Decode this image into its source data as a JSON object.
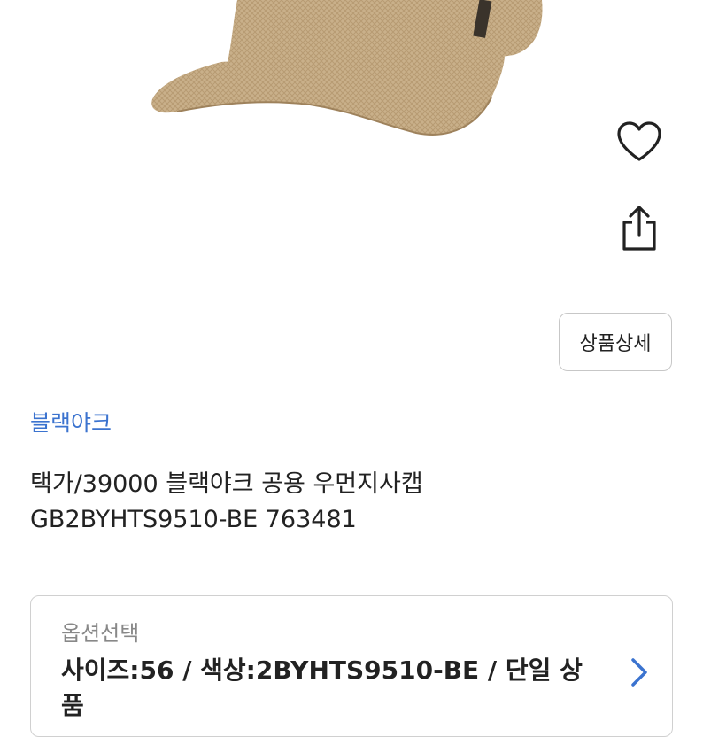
{
  "product": {
    "brand": "블랙야크",
    "title_line1": "택가/39000 블랙야크 공용 우먼지사캡",
    "title_line2": "GB2BYHTS9510-BE 763481"
  },
  "actions": {
    "detail_button_label": "상품상세",
    "wishlist_icon": "heart-icon",
    "share_icon": "share-icon"
  },
  "option": {
    "label": "옵션선택",
    "selected_value": "사이즈:56 / 색상:2BYHTS9510-BE / 단일 상품"
  },
  "colors": {
    "brand_link": "#3b73cf",
    "chevron": "#3b73cf",
    "border": "#c7c7c7"
  }
}
